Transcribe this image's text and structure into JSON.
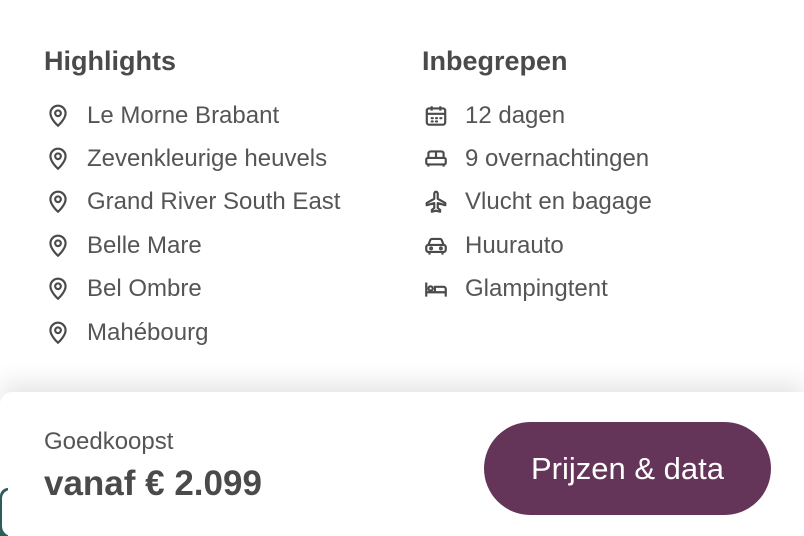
{
  "highlights": {
    "title": "Highlights",
    "items": [
      {
        "label": "Le Morne Brabant",
        "icon": "map-pin-icon"
      },
      {
        "label": "Zevenkleurige heuvels",
        "icon": "map-pin-icon"
      },
      {
        "label": "Grand River South East",
        "icon": "map-pin-icon"
      },
      {
        "label": "Belle Mare",
        "icon": "map-pin-icon"
      },
      {
        "label": "Bel Ombre",
        "icon": "map-pin-icon"
      },
      {
        "label": "Mahébourg",
        "icon": "map-pin-icon"
      }
    ]
  },
  "included": {
    "title": "Inbegrepen",
    "items": [
      {
        "label": "12 dagen",
        "icon": "calendar-icon"
      },
      {
        "label": "9 overnachtingen",
        "icon": "bed-icon"
      },
      {
        "label": "Vlucht en bagage",
        "icon": "airplane-icon"
      },
      {
        "label": "Huurauto",
        "icon": "car-icon"
      },
      {
        "label": "Glampingtent",
        "icon": "bed-person-icon"
      }
    ]
  },
  "footer": {
    "cheapest_label": "Goedkoopst",
    "price": "vanaf € 2.099",
    "cta_label": "Prijzen & data"
  },
  "colors": {
    "accent": "#643559",
    "text": "#4a4a4a"
  }
}
